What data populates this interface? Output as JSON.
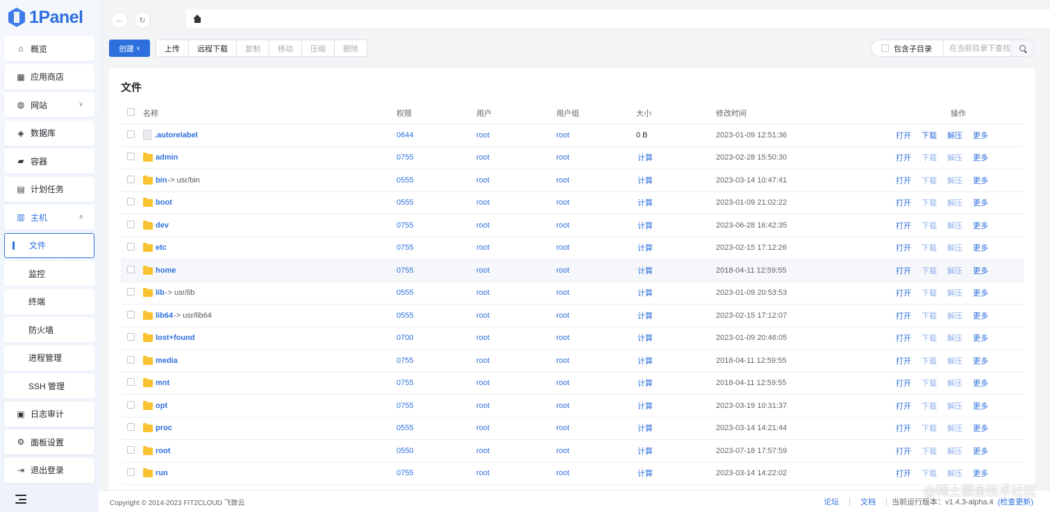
{
  "brand": {
    "name": "1Panel"
  },
  "sidebar": {
    "items": [
      {
        "label": "概览",
        "icon": "home-icon"
      },
      {
        "label": "应用商店",
        "icon": "grid-icon"
      },
      {
        "label": "网站",
        "icon": "globe-icon",
        "arrow": "∨"
      },
      {
        "label": "数据库",
        "icon": "layers-icon"
      },
      {
        "label": "容器",
        "icon": "docker-icon"
      },
      {
        "label": "计划任务",
        "icon": "calendar-icon"
      },
      {
        "label": "主机",
        "icon": "server-icon",
        "arrow": "∧"
      }
    ],
    "host_sub": [
      {
        "label": "文件"
      },
      {
        "label": "监控"
      },
      {
        "label": "终端"
      },
      {
        "label": "防火墙"
      },
      {
        "label": "进程管理"
      },
      {
        "label": "SSH 管理"
      }
    ],
    "bottom_items": [
      {
        "label": "日志审计",
        "icon": "log-icon"
      },
      {
        "label": "面板设置",
        "icon": "gear-icon"
      },
      {
        "label": "退出登录",
        "icon": "logout-icon"
      }
    ]
  },
  "toolbar": {
    "create": "创建",
    "upload": "上传",
    "remote_download": "远程下载",
    "copy": "复制",
    "move": "移动",
    "compress": "压缩",
    "delete": "删除",
    "include_subdir": "包含子目录",
    "search_placeholder": "在当前目录下查找"
  },
  "main": {
    "title": "文件",
    "columns": [
      "名称",
      "权限",
      "用户",
      "用户组",
      "大小",
      "修改时间",
      "操作"
    ],
    "ops": [
      "打开",
      "下载",
      "解压",
      "更多"
    ],
    "calc_label": "计算",
    "rows": [
      {
        "name": ".autorelabel",
        "link": "",
        "type": "file",
        "perm": "0644",
        "user": "root",
        "group": "root",
        "size": "0 B",
        "mtime": "2023-01-09 12:51:36"
      },
      {
        "name": "admin",
        "link": "",
        "type": "dir",
        "perm": "0755",
        "user": "root",
        "group": "root",
        "size": "",
        "mtime": "2023-02-28 15:50:30"
      },
      {
        "name": "bin",
        "link": "-> usr/bin",
        "type": "dir",
        "perm": "0555",
        "user": "root",
        "group": "root",
        "size": "",
        "mtime": "2023-03-14 10:47:41"
      },
      {
        "name": "boot",
        "link": "",
        "type": "dir",
        "perm": "0555",
        "user": "root",
        "group": "root",
        "size": "",
        "mtime": "2023-01-09 21:02:22"
      },
      {
        "name": "dev",
        "link": "",
        "type": "dir",
        "perm": "0755",
        "user": "root",
        "group": "root",
        "size": "",
        "mtime": "2023-06-28 16:42:35"
      },
      {
        "name": "etc",
        "link": "",
        "type": "dir",
        "perm": "0755",
        "user": "root",
        "group": "root",
        "size": "",
        "mtime": "2023-02-15 17:12:26"
      },
      {
        "name": "home",
        "link": "",
        "type": "dir",
        "perm": "0755",
        "user": "root",
        "group": "root",
        "size": "",
        "mtime": "2018-04-11 12:59:55"
      },
      {
        "name": "lib",
        "link": "-> usr/lib",
        "type": "dir",
        "perm": "0555",
        "user": "root",
        "group": "root",
        "size": "",
        "mtime": "2023-01-09 20:53:53"
      },
      {
        "name": "lib64",
        "link": "-> usr/lib64",
        "type": "dir",
        "perm": "0555",
        "user": "root",
        "group": "root",
        "size": "",
        "mtime": "2023-02-15 17:12:07"
      },
      {
        "name": "lost+found",
        "link": "",
        "type": "dir",
        "perm": "0700",
        "user": "root",
        "group": "root",
        "size": "",
        "mtime": "2023-01-09 20:46:05"
      },
      {
        "name": "media",
        "link": "",
        "type": "dir",
        "perm": "0755",
        "user": "root",
        "group": "root",
        "size": "",
        "mtime": "2018-04-11 12:59:55"
      },
      {
        "name": "mnt",
        "link": "",
        "type": "dir",
        "perm": "0755",
        "user": "root",
        "group": "root",
        "size": "",
        "mtime": "2018-04-11 12:59:55"
      },
      {
        "name": "opt",
        "link": "",
        "type": "dir",
        "perm": "0755",
        "user": "root",
        "group": "root",
        "size": "",
        "mtime": "2023-03-19 10:31:37"
      },
      {
        "name": "proc",
        "link": "",
        "type": "dir",
        "perm": "0555",
        "user": "root",
        "group": "root",
        "size": "",
        "mtime": "2023-03-14 14:21:44"
      },
      {
        "name": "root",
        "link": "",
        "type": "dir",
        "perm": "0550",
        "user": "root",
        "group": "root",
        "size": "",
        "mtime": "2023-07-18 17:57:59"
      },
      {
        "name": "run",
        "link": "",
        "type": "dir",
        "perm": "0755",
        "user": "root",
        "group": "root",
        "size": "",
        "mtime": "2023-03-14 14:22:02"
      }
    ]
  },
  "footer": {
    "copyright": "Copyright © 2014-2023 FIT2CLOUD 飞致云",
    "forum": "论坛",
    "docs": "文档",
    "version_label": "当前运行版本：v1.4.3-alpha.4",
    "check_update": "(检查更新)"
  },
  "watermark": "@稀土掘金技术社区",
  "colors": {
    "accent": "#2d6fdd",
    "folder": "#f9c230"
  }
}
